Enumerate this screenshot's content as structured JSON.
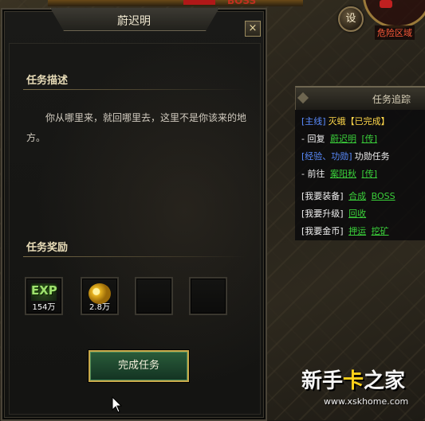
{
  "dialog": {
    "title": "蔚迟明",
    "close": "×",
    "description_heading": "任务描述",
    "description": "你从哪里来，就回哪里去，这里不是你该来的地方。",
    "reward_heading": "任务奖励",
    "rewards": [
      {
        "icon": "exp-icon",
        "label": "EXP",
        "count": "154万"
      },
      {
        "icon": "gold-coins-icon",
        "count": "2.8万"
      },
      {
        "icon": "empty-slot",
        "count": ""
      },
      {
        "icon": "empty-slot",
        "count": ""
      }
    ],
    "complete_button": "完成任务"
  },
  "hud": {
    "settings_label": "设",
    "danger_zone": "危险区域",
    "top_partial_text": "BOSS"
  },
  "tracker": {
    "title": "任务追踪",
    "rows": {
      "main_tag": "[主线]",
      "main_name": "灭蛾【已完成】",
      "main_action": "- 回复",
      "main_npc": "蔚迟明",
      "main_teleport": "[传]",
      "exp_tag": "[经验、功勋]",
      "exp_name": "功勋任务",
      "exp_action": "- 前往",
      "exp_npc": "案阳秋",
      "exp_teleport": "[传]",
      "equip_tag": "[我要装备]",
      "equip_link1": "合成",
      "equip_link2": "BOSS",
      "level_tag": "[我要升级]",
      "level_link1": "回收",
      "gold_tag": "[我要金币]",
      "gold_link1": "押运",
      "gold_link2": "挖矿"
    }
  },
  "watermark": {
    "text_a": "新",
    "text_b": "手",
    "text_c": "卡",
    "text_d": "之家",
    "url": "www.xskhome.com"
  },
  "colors": {
    "quest_link_green": "#3ad03a",
    "tag_blue": "#5a8cff",
    "status_yellow": "#ffd84a",
    "button_border_gold": "#c8a84a"
  }
}
